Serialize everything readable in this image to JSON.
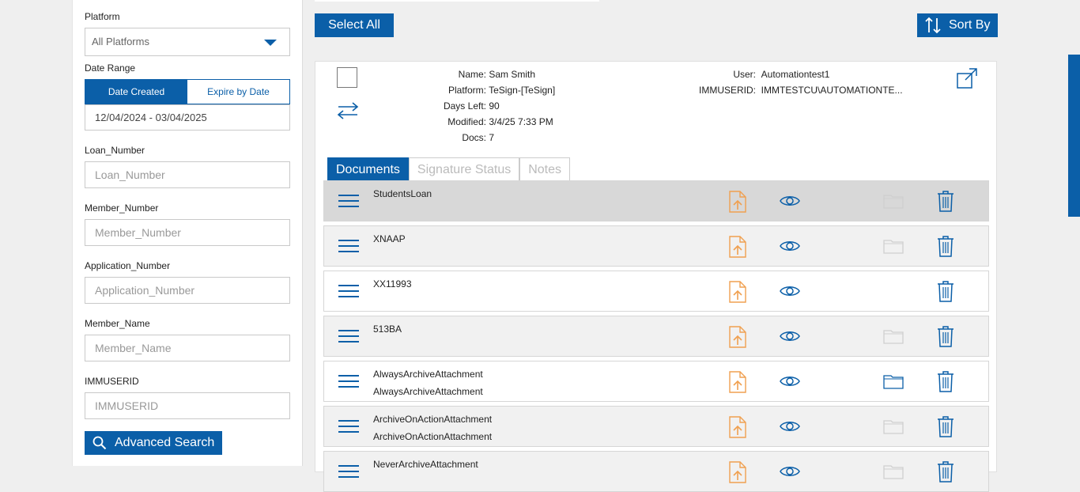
{
  "filters": {
    "platform_label": "Platform",
    "platform_value": "All Platforms",
    "date_range_label": "Date Range",
    "date_created_label": "Date Created",
    "expire_by_date_label": "Expire by Date",
    "date_range_value": "12/04/2024 - 03/04/2025",
    "loan_number_label": "Loan_Number",
    "loan_number_placeholder": "Loan_Number",
    "member_number_label": "Member_Number",
    "member_number_placeholder": "Member_Number",
    "application_number_label": "Application_Number",
    "application_number_placeholder": "Application_Number",
    "member_name_label": "Member_Name",
    "member_name_placeholder": "Member_Name",
    "immuserid_label": "IMMUSERID",
    "immuserid_placeholder": "IMMUSERID",
    "advanced_search_label": "Advanced Search"
  },
  "toolbar": {
    "select_all_label": "Select All",
    "sort_by_label": "Sort By"
  },
  "record": {
    "name_key": "Name:",
    "name_value": "Sam Smith",
    "platform_key": "Platform:",
    "platform_value": "TeSign-[TeSign]",
    "days_left_key": "Days Left:",
    "days_left_value": "90",
    "modified_key": "Modified:",
    "modified_value": "3/4/25 7:33 PM",
    "docs_key": "Docs:",
    "docs_value": "7",
    "user_key": "User:",
    "user_value": "Automationtest1",
    "immuserid_key": "IMMUSERID:",
    "immuserid_value": "IMMTESTCU\\AUTOMATIONTE..."
  },
  "tabs": [
    "Documents",
    "Signature Status",
    "Notes"
  ],
  "documents": [
    {
      "line1": "StudentsLoan",
      "line2": "",
      "folder": "faded"
    },
    {
      "line1": "XNAAP",
      "line2": "",
      "folder": "faded"
    },
    {
      "line1": "XX11993",
      "line2": "",
      "folder": "none"
    },
    {
      "line1": "513BA",
      "line2": "",
      "folder": "faded"
    },
    {
      "line1": "AlwaysArchiveAttachment",
      "line2": "AlwaysArchiveAttachment",
      "folder": "active"
    },
    {
      "line1": "ArchiveOnActionAttachment",
      "line2": "ArchiveOnActionAttachment",
      "folder": "faded"
    },
    {
      "line1": "NeverArchiveAttachment",
      "line2": "",
      "folder": "faded"
    }
  ],
  "colors": {
    "accent": "#0b5fa8",
    "upload": "#f0a050",
    "folder_faded": "#c8c8c8"
  },
  "icons": [
    "caret-down-icon",
    "search-icon",
    "sort-icon",
    "swap-icon",
    "external-link-icon",
    "menu-icon",
    "upload-document-icon",
    "eye-icon",
    "folder-icon",
    "trash-icon"
  ]
}
